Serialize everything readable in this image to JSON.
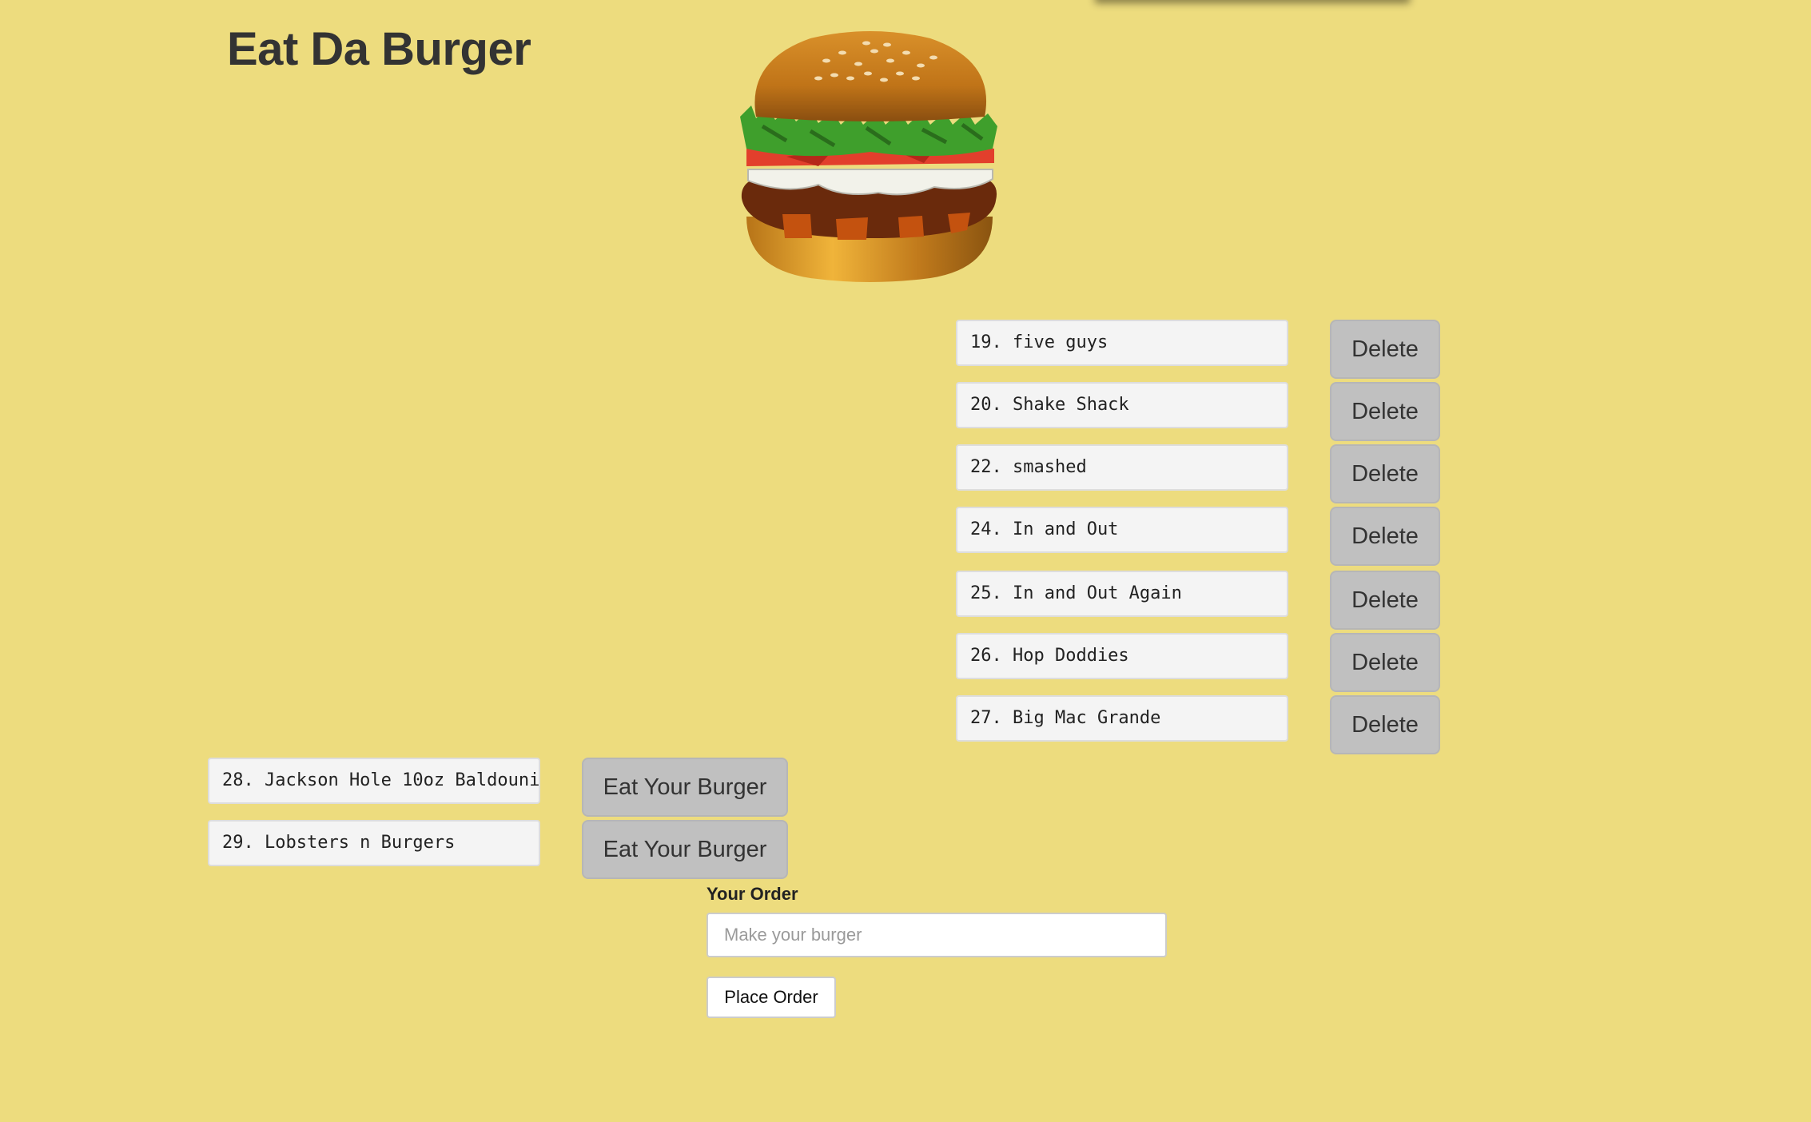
{
  "page": {
    "title": "Eat Da Burger"
  },
  "devoured": [
    {
      "label": "19. five guys",
      "button": "Delete"
    },
    {
      "label": "20. Shake Shack",
      "button": "Delete"
    },
    {
      "label": "22. smashed",
      "button": "Delete"
    },
    {
      "label": "24. In and Out",
      "button": "Delete"
    },
    {
      "label": "25. In and Out Again",
      "button": "Delete"
    },
    {
      "label": "26. Hop Doddies",
      "button": "Delete"
    },
    {
      "label": "27. Big Mac Grande",
      "button": "Delete"
    }
  ],
  "to_eat": [
    {
      "label": "28. Jackson Hole 10oz Baldouni",
      "button": "Eat Your Burger"
    },
    {
      "label": "29. Lobsters n Burgers",
      "button": "Eat Your Burger"
    }
  ],
  "order_form": {
    "label": "Your Order",
    "placeholder": "Make your burger",
    "value": "",
    "submit": "Place Order"
  },
  "icons": {
    "logo": "burger-image"
  },
  "colors": {
    "background": "#eddc7e",
    "button": "#c0c0c0",
    "item_box": "#f4f4f4"
  }
}
